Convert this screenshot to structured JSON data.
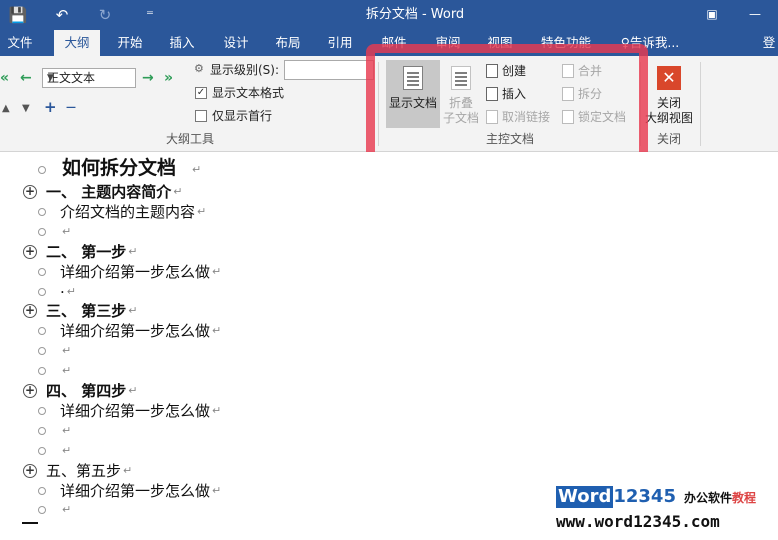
{
  "titlebar": {
    "title": "拆分文档 - Word",
    "save_icon": "💾",
    "undo_icon": "↶",
    "redo_icon": "↻",
    "customize_icon": "⁼",
    "ribbon_display_icon": "▣",
    "minimize_icon": "—"
  },
  "tabs": [
    {
      "label": "文件"
    },
    {
      "label": "大纲"
    },
    {
      "label": "开始"
    },
    {
      "label": "插入"
    },
    {
      "label": "设计"
    },
    {
      "label": "布局"
    },
    {
      "label": "引用"
    },
    {
      "label": "邮件"
    },
    {
      "label": "审阅"
    },
    {
      "label": "视图"
    },
    {
      "label": "特色功能"
    },
    {
      "label": "♀告诉我..."
    },
    {
      "label": "登"
    }
  ],
  "outline_tools": {
    "level_dropdown_value": "正文文本",
    "show_level_label": "显示级别(S):",
    "show_text_format_label": "显示文本格式",
    "show_first_line_only_label": "仅显示首行",
    "group_label": "大纲工具",
    "promote_to_heading1": "«",
    "promote": "←",
    "demote": "→",
    "demote_to_body": "»",
    "move_up": "▲",
    "move_down": "▼",
    "expand": "+",
    "collapse": "—"
  },
  "master_document": {
    "show_document_label": "显示文档",
    "collapse_subdocuments_label_1": "折叠",
    "collapse_subdocuments_label_2": "子文档",
    "create_label": "创建",
    "insert_label": "插入",
    "unlink_label": "取消链接",
    "merge_label": "合并",
    "split_label": "拆分",
    "lock_document_label": "锁定文档",
    "group_label": "主控文档"
  },
  "close_group": {
    "close_label_1": "关闭",
    "close_label_2": "大纲视图",
    "group_label": "关闭",
    "close_icon_glyph": "✕"
  },
  "document": {
    "title": "如何拆分文档",
    "lines": [
      {
        "bullet": "plus",
        "text": "一、   主题内容简介",
        "bold": true
      },
      {
        "bullet": "circle",
        "text": "介绍文档的主题内容",
        "bold": false
      },
      {
        "bullet": "circle",
        "text": "",
        "bold": false
      },
      {
        "bullet": "plus",
        "text": "二、   第一步",
        "bold": true
      },
      {
        "bullet": "circle",
        "text": "详细介绍第一步怎么做",
        "bold": false
      },
      {
        "bullet": "circle",
        "text": "·",
        "bold": false
      },
      {
        "bullet": "plus",
        "text": "三、   第三步",
        "bold": true
      },
      {
        "bullet": "circle",
        "text": "详细介绍第一步怎么做",
        "bold": false
      },
      {
        "bullet": "circle",
        "text": "",
        "bold": false
      },
      {
        "bullet": "circle",
        "text": "",
        "bold": false
      },
      {
        "bullet": "plus",
        "text": "四、   第四步",
        "bold": true
      },
      {
        "bullet": "circle",
        "text": "详细介绍第一步怎么做",
        "bold": false
      },
      {
        "bullet": "circle",
        "text": "",
        "bold": false
      },
      {
        "bullet": "circle",
        "text": "",
        "bold": false
      },
      {
        "bullet": "plus",
        "text": "五、第五步",
        "bold": false
      },
      {
        "bullet": "circle",
        "text": "详细介绍第一步怎么做",
        "bold": false
      },
      {
        "bullet": "circle",
        "text": "",
        "bold": false
      }
    ],
    "paragraph_mark": "↵",
    "plus_glyph": "+"
  },
  "watermark": {
    "brand_box": "Word",
    "brand_rest": "12345",
    "slogan_1": "办公软件",
    "slogan_2": "教程",
    "url": "www.word12345.com"
  },
  "colors": {
    "title_bar": "#2b579a",
    "highlight": "#e83a50",
    "close_button": "#d9472b"
  }
}
